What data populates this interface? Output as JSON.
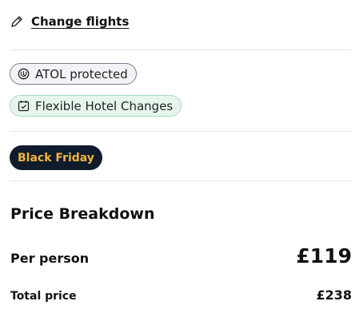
{
  "actions": {
    "change_flights_label": "Change flights",
    "change_flights_icon": "pencil-icon"
  },
  "badges": [
    {
      "label": "ATOL protected",
      "icon": "atol-shield-icon",
      "border": "#7a7a8c",
      "background": "#f3f3f7"
    },
    {
      "label": "Flexible Hotel Changes",
      "icon": "calendar-check-icon",
      "border": "#a5dcbc",
      "background": "#e6f6ec"
    }
  ],
  "promo": {
    "label": "Black Friday",
    "background": "#101c2c",
    "text_color": "#f4b63b"
  },
  "price_breakdown": {
    "title": "Price Breakdown",
    "per_person_label": "Per person",
    "per_person_value": "£119",
    "total_label": "Total price",
    "total_value": "£238"
  }
}
